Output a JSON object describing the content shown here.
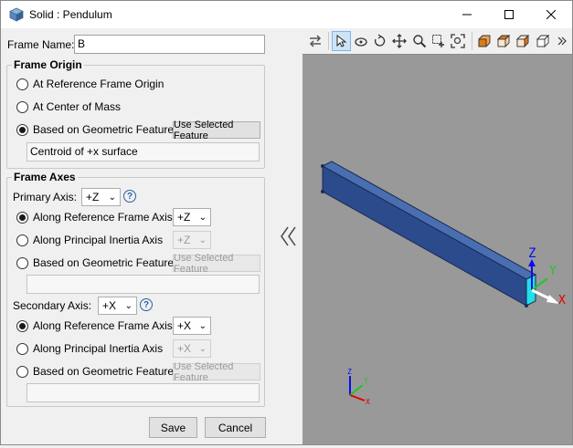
{
  "window": {
    "title": "Solid : Pendulum"
  },
  "form": {
    "frame_name_label": "Frame Name:",
    "frame_name_value": "B",
    "frame_origin": {
      "title": "Frame Origin",
      "options": [
        "At Reference Frame Origin",
        "At Center of Mass",
        "Based on Geometric Feature"
      ],
      "selected": "Based on Geometric Feature",
      "use_selected_label": "Use Selected Feature",
      "feature_value": "Centroid of +x surface"
    },
    "frame_axes": {
      "title": "Frame Axes",
      "primary": {
        "label": "Primary Axis:",
        "axis_value": "+Z",
        "options": [
          "Along Reference Frame Axis",
          "Along Principal Inertia Axis",
          "Based on Geometric Feature"
        ],
        "selected": "Along Reference Frame Axis",
        "ref_axis_value": "+Z",
        "principal_axis_value": "+Z",
        "use_selected_label": "Use Selected Feature",
        "feature_value": ""
      },
      "secondary": {
        "label": "Secondary Axis:",
        "axis_value": "+X",
        "options": [
          "Along Reference Frame Axis",
          "Along Principal Inertia Axis",
          "Based on Geometric Feature"
        ],
        "selected": "Along Reference Frame Axis",
        "ref_axis_value": "+X",
        "principal_axis_value": "+X",
        "use_selected_label": "Use Selected Feature",
        "feature_value": ""
      }
    },
    "save_label": "Save",
    "cancel_label": "Cancel",
    "help_glyph": "?"
  },
  "viewer": {
    "background_color": "#999999",
    "body_color": "#2b4b8c",
    "triad_labels": {
      "x": "X",
      "y": "Y",
      "z": "Z"
    },
    "toolbar_icons": [
      "swap-icon",
      "select-icon",
      "rotate-icon",
      "roll-icon",
      "pan-icon",
      "zoom-icon",
      "zoom-box-icon",
      "fit-view-icon",
      "front-view-icon",
      "top-view-icon",
      "side-view-icon",
      "iso-view-icon",
      "more-icon"
    ]
  }
}
